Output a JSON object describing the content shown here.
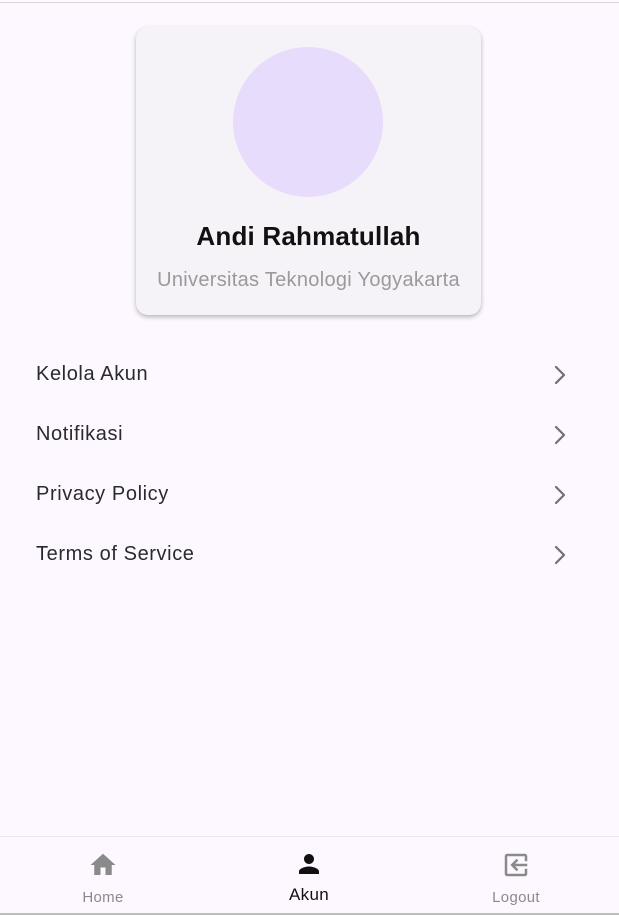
{
  "profile": {
    "name": "Andi Rahmatullah",
    "university": "Universitas Teknologi Yogyakarta"
  },
  "menu": {
    "items": [
      {
        "label": "Kelola Akun",
        "icon": "chevron-right-icon"
      },
      {
        "label": "Notifikasi",
        "icon": "chevron-right-icon"
      },
      {
        "label": "Privacy Policy",
        "icon": "chevron-right-icon"
      },
      {
        "label": "Terms of Service",
        "icon": "chevron-right-icon"
      }
    ]
  },
  "bottom_nav": {
    "items": [
      {
        "label": "Home",
        "icon": "home-icon",
        "active": false
      },
      {
        "label": "Akun",
        "icon": "person-icon",
        "active": true
      },
      {
        "label": "Logout",
        "icon": "logout-icon",
        "active": false
      }
    ]
  },
  "colors": {
    "background": "#fdf7ff",
    "card": "#f5f2f8",
    "avatar": "#e8dcfd",
    "active_nav": "#111111",
    "inactive_nav": "#8a8a8a",
    "secondary_text": "#9a9a9a"
  }
}
